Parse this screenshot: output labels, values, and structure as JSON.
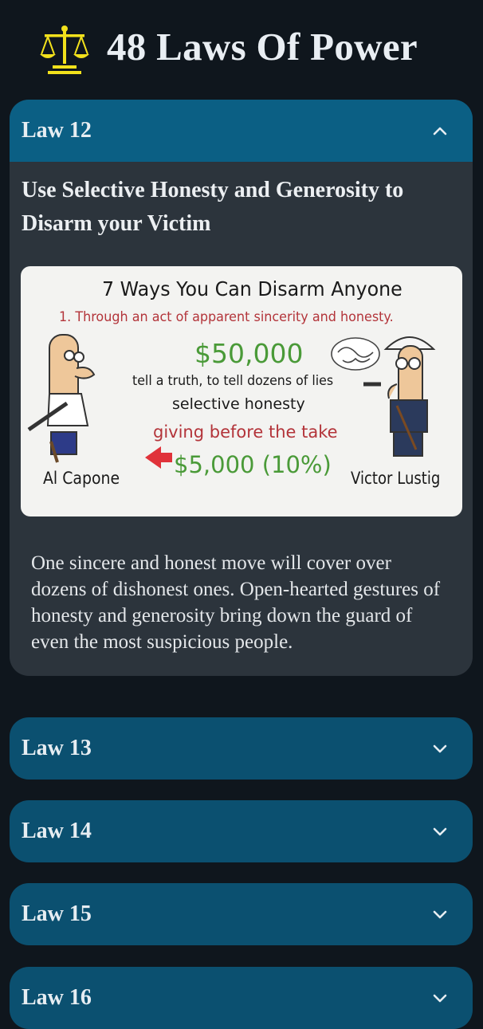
{
  "app": {
    "title": "48 Laws Of Power",
    "logo_icon": "scales-of-justice-icon",
    "accent": "#f2e11c"
  },
  "laws": [
    {
      "label": "Law 12",
      "expanded": true,
      "title": "Use Selective Honesty and Generosity to Disarm your Victim",
      "illustration": {
        "heading": "7 Ways You Can Disarm Anyone",
        "subheading": "1. Through an act of apparent sincerity and honesty.",
        "amount_large": "$50,000",
        "line1": "tell a truth, to tell dozens of lies",
        "line2": "selective honesty",
        "line3": "giving before the take",
        "amount_small": "$5,000 (10%)",
        "left_name": "Al Capone",
        "right_name": "Victor Lustig"
      },
      "description": "One sincere and honest move will cover over dozens of dishonest ones. Open-hearted gestures of honesty and generosity bring down the guard of even the most suspicious people."
    },
    {
      "label": "Law 13",
      "expanded": false
    },
    {
      "label": "Law 14",
      "expanded": false
    },
    {
      "label": "Law 15",
      "expanded": false
    },
    {
      "label": "Law 16",
      "expanded": false
    }
  ],
  "colors": {
    "background": "#0f161d",
    "card_collapsed": "#0b5070",
    "card_open_header": "#0b5f84",
    "card_open_body": "#2c343c"
  }
}
